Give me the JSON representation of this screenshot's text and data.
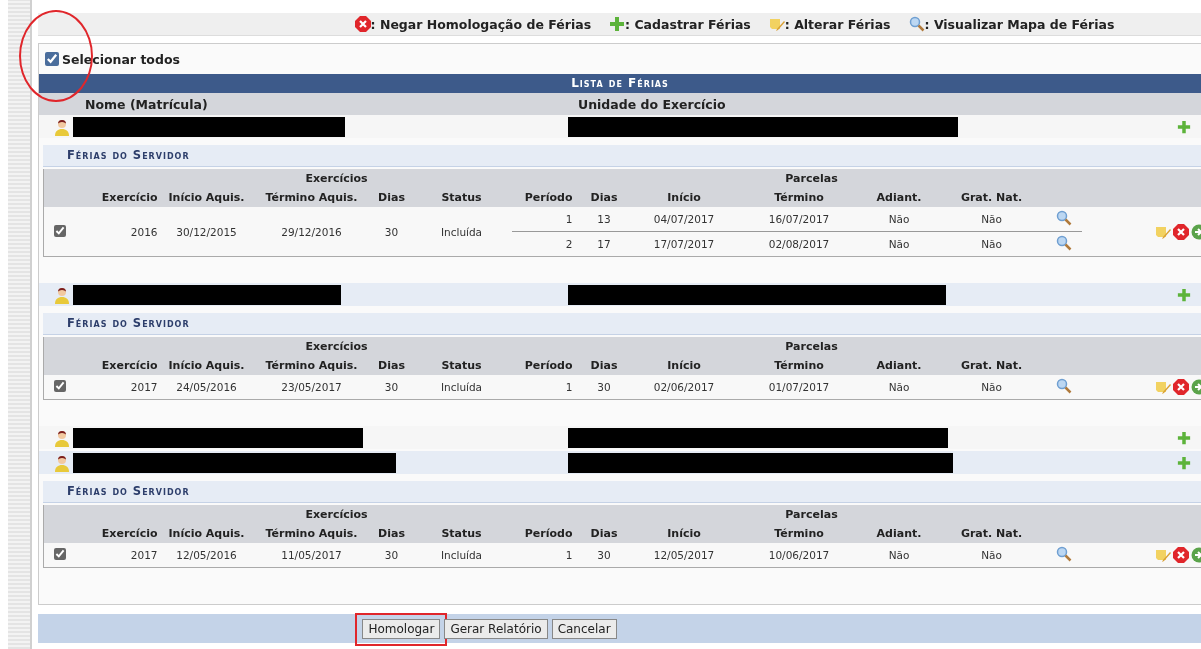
{
  "legend": [
    {
      "kind": "deny",
      "label": ": Negar Homologação de Férias"
    },
    {
      "kind": "add",
      "label": ": Cadastrar Férias"
    },
    {
      "kind": "edit",
      "label": ": Alterar Férias"
    },
    {
      "kind": "view",
      "label": ": Visualizar Mapa de Férias"
    }
  ],
  "select_all": {
    "label": "Selecionar todos",
    "checked": true,
    "circled": true
  },
  "list": {
    "title": "Lista de Férias",
    "columns": [
      "Nome (Matrícula)",
      "Unidade do Exercício"
    ]
  },
  "servers": [
    {
      "redacted": true,
      "ferias": {
        "title": "Férias do Servidor",
        "group_headers": [
          "Exercícios",
          "Parcelas"
        ],
        "columns": [
          "Exercício",
          "Início Aquis.",
          "Término Aquis.",
          "Dias",
          "Status",
          "Período",
          "Dias",
          "Início",
          "Término",
          "Adiant.",
          "Grat. Nat."
        ],
        "rows": [
          {
            "checked": true,
            "exercicio": "2016",
            "inicio_aquis": "30/12/2015",
            "termino_aquis": "29/12/2016",
            "dias": "30",
            "status": "Incluída",
            "parcelas": [
              {
                "periodo": "1",
                "dias": "13",
                "inicio": "04/07/2017",
                "termino": "16/07/2017",
                "adiant": "Não",
                "grat_nat": "Não"
              },
              {
                "periodo": "2",
                "dias": "17",
                "inicio": "17/07/2017",
                "termino": "02/08/2017",
                "adiant": "Não",
                "grat_nat": "Não"
              }
            ]
          }
        ]
      }
    },
    {
      "redacted": true,
      "ferias": {
        "title": "Férias do Servidor",
        "group_headers": [
          "Exercícios",
          "Parcelas"
        ],
        "columns": [
          "Exercício",
          "Início Aquis.",
          "Término Aquis.",
          "Dias",
          "Status",
          "Período",
          "Dias",
          "Início",
          "Término",
          "Adiant.",
          "Grat. Nat."
        ],
        "rows": [
          {
            "checked": true,
            "exercicio": "2017",
            "inicio_aquis": "24/05/2016",
            "termino_aquis": "23/05/2017",
            "dias": "30",
            "status": "Incluída",
            "parcelas": [
              {
                "periodo": "1",
                "dias": "30",
                "inicio": "02/06/2017",
                "termino": "01/07/2017",
                "adiant": "Não",
                "grat_nat": "Não"
              }
            ]
          }
        ]
      }
    },
    {
      "redacted": true
    },
    {
      "redacted": true,
      "ferias": {
        "title": "Férias do Servidor",
        "group_headers": [
          "Exercícios",
          "Parcelas"
        ],
        "columns": [
          "Exercício",
          "Início Aquis.",
          "Término Aquis.",
          "Dias",
          "Status",
          "Período",
          "Dias",
          "Início",
          "Término",
          "Adiant.",
          "Grat. Nat."
        ],
        "rows": [
          {
            "checked": true,
            "exercicio": "2017",
            "inicio_aquis": "12/05/2016",
            "termino_aquis": "11/05/2017",
            "dias": "30",
            "status": "Incluída",
            "parcelas": [
              {
                "periodo": "1",
                "dias": "30",
                "inicio": "12/05/2017",
                "termino": "10/06/2017",
                "adiant": "Não",
                "grat_nat": "Não"
              }
            ]
          }
        ]
      }
    }
  ],
  "buttons": [
    {
      "label": "Homologar",
      "highlighted": true
    },
    {
      "label": "Gerar Relatório",
      "highlighted": false
    },
    {
      "label": "Cancelar",
      "highlighted": false
    }
  ]
}
